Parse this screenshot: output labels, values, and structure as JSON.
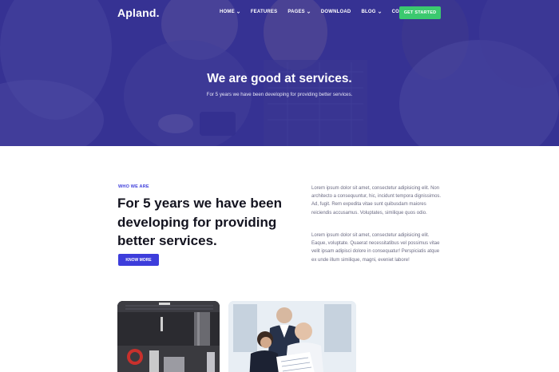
{
  "brand": {
    "logo": "Apland."
  },
  "nav": {
    "items": [
      {
        "label": "HOME",
        "has_dropdown": true
      },
      {
        "label": "FEATURES",
        "has_dropdown": false
      },
      {
        "label": "PAGES",
        "has_dropdown": true
      },
      {
        "label": "DOWNLOAD",
        "has_dropdown": false
      },
      {
        "label": "BLOG",
        "has_dropdown": true
      },
      {
        "label": "CONTACT",
        "has_dropdown": false
      }
    ],
    "cta": "GET STARTED"
  },
  "hero": {
    "title": "We are good at services.",
    "subtitle": "For 5 years we have been developing for providing better services."
  },
  "about": {
    "eyebrow": "WHO WE ARE",
    "heading": "For 5 years we have been developing for providing better services.",
    "button": "KNOW MORE",
    "paragraphs": [
      "Lorem ipsum dolor sit amet, consectetur adipisicing elit. Non architecto a consequuntur, hic, incidunt tempora dignissimos. Ad, fugit. Rem expedita vitae sunt quibusdam maiores reiciendis accusamus. Voluptates, similique quos odio.",
      "Lorem ipsum dolor sit amet, consectetur adipisicing elit. Eaque, voluptate. Quaerat necessitatibus vel possimus vitae velit ipsam adipisci dolore in consequatur! Perspiciatis atque ex unde illum similique, magni, eveniet labore!"
    ]
  },
  "colors": {
    "hero_overlay": "#2f2b86",
    "cta_green": "#3bc96f",
    "accent_blue": "#3d3ddb",
    "heading_dark": "#13131f",
    "body_gray": "#6b6b83"
  },
  "icons": {
    "dropdown": "chevron-down-icon"
  }
}
